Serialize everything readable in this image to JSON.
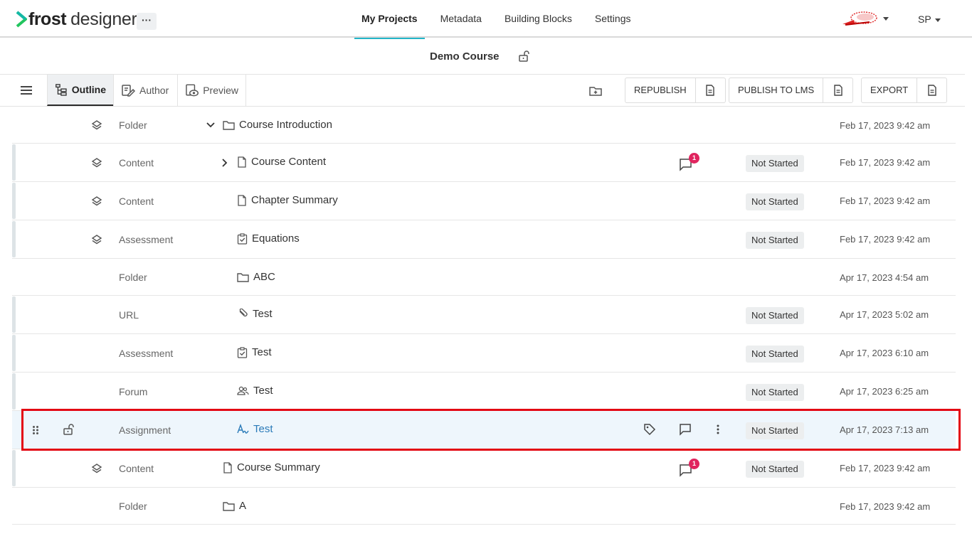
{
  "app": {
    "logo_bold": "frost",
    "logo_light": "designer",
    "more_label": "···",
    "brand_color": "#22b5c8"
  },
  "nav": {
    "tabs": [
      {
        "label": "My Projects",
        "active": true
      },
      {
        "label": "Metadata",
        "active": false
      },
      {
        "label": "Building Blocks",
        "active": false
      },
      {
        "label": "Settings",
        "active": false
      }
    ],
    "user_initials": "SP"
  },
  "course": {
    "title": "Demo Course"
  },
  "toolbar": {
    "views": [
      {
        "label": "Outline",
        "icon": "outline-tree-icon",
        "active": true
      },
      {
        "label": "Author",
        "icon": "author-edit-icon",
        "active": false
      },
      {
        "label": "Preview",
        "icon": "preview-eye-icon",
        "active": false
      }
    ],
    "republish_label": "REPUBLISH",
    "publish_lms_label": "PUBLISH TO LMS",
    "export_label": "EXPORT"
  },
  "rows": [
    {
      "type": "Folder",
      "name": "Course Introduction",
      "icon": "folder-icon",
      "status": "",
      "date": "Feb 17, 2023 9:42 am",
      "expanded": true
    },
    {
      "type": "Content",
      "name": "Course Content",
      "icon": "page-icon",
      "status": "Not Started",
      "date": "Feb 17, 2023 9:42 am",
      "comments": "1"
    },
    {
      "type": "Content",
      "name": "Chapter Summary",
      "icon": "page-icon",
      "status": "Not Started",
      "date": "Feb 17, 2023 9:42 am"
    },
    {
      "type": "Assessment",
      "name": "Equations",
      "icon": "checklist-icon",
      "status": "Not Started",
      "date": "Feb 17, 2023 9:42 am"
    },
    {
      "type": "Folder",
      "name": "ABC",
      "icon": "folder-icon",
      "status": "",
      "date": "Apr 17, 2023 4:54 am"
    },
    {
      "type": "URL",
      "name": "Test",
      "icon": "link-icon",
      "status": "Not Started",
      "date": "Apr 17, 2023 5:02 am"
    },
    {
      "type": "Assessment",
      "name": "Test",
      "icon": "checklist-icon",
      "status": "Not Started",
      "date": "Apr 17, 2023 6:10 am"
    },
    {
      "type": "Forum",
      "name": "Test",
      "icon": "people-icon",
      "status": "Not Started",
      "date": "Apr 17, 2023 6:25 am"
    },
    {
      "type": "Assignment",
      "name": "Test",
      "icon": "assignment-icon",
      "status": "Not Started",
      "date": "Apr 17, 2023 7:13 am",
      "selected": true
    },
    {
      "type": "Content",
      "name": "Course Summary",
      "icon": "page-icon",
      "status": "Not Started",
      "date": "Feb 17, 2023 9:42 am",
      "comments": "1"
    },
    {
      "type": "Folder",
      "name": "A",
      "icon": "folder-icon",
      "status": "",
      "date": "Feb 17, 2023 9:42 am"
    }
  ]
}
